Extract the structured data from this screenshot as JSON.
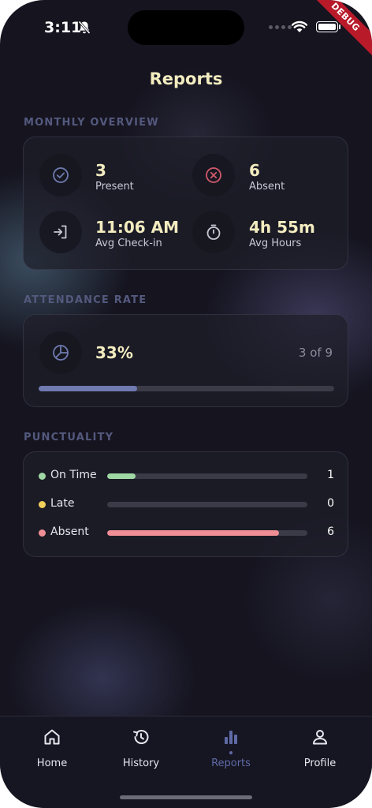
{
  "status_bar": {
    "time": "3:11",
    "debug_banner": "DEBUG"
  },
  "header": {
    "title": "Reports"
  },
  "monthly_overview": {
    "label": "MONTHLY OVERVIEW",
    "stats": [
      {
        "value": "3",
        "label": "Present",
        "icon": "check-circle-icon",
        "icon_color": "#6f7bb0"
      },
      {
        "value": "6",
        "label": "Absent",
        "icon": "x-circle-icon",
        "icon_color": "#d05a6a"
      },
      {
        "value": "11:06 AM",
        "label": "Avg Check-in",
        "icon": "login-icon",
        "icon_color": "#c9c9d6"
      },
      {
        "value": "4h 55m",
        "label": "Avg Hours",
        "icon": "timer-icon",
        "icon_color": "#c9c9d6"
      }
    ]
  },
  "attendance_rate": {
    "label": "ATTENDANCE RATE",
    "value": "33%",
    "count_text": "3 of 9",
    "progress": 0.333,
    "bar_color": "#6f7bb0"
  },
  "punctuality": {
    "label": "PUNCTUALITY",
    "rows": [
      {
        "label": "On Time",
        "count": "1",
        "fraction": 0.143,
        "color": "#9fd8a4"
      },
      {
        "label": "Late",
        "count": "0",
        "fraction": 0.0,
        "color": "#f1cf5a"
      },
      {
        "label": "Absent",
        "count": "6",
        "fraction": 0.857,
        "color": "#ef8f95"
      }
    ]
  },
  "nav": {
    "items": [
      {
        "label": "Home",
        "icon": "home-icon"
      },
      {
        "label": "History",
        "icon": "history-icon"
      },
      {
        "label": "Reports",
        "icon": "bar-chart-icon",
        "active": true
      },
      {
        "label": "Profile",
        "icon": "person-icon"
      }
    ],
    "active_color": "#5f6aa6"
  }
}
